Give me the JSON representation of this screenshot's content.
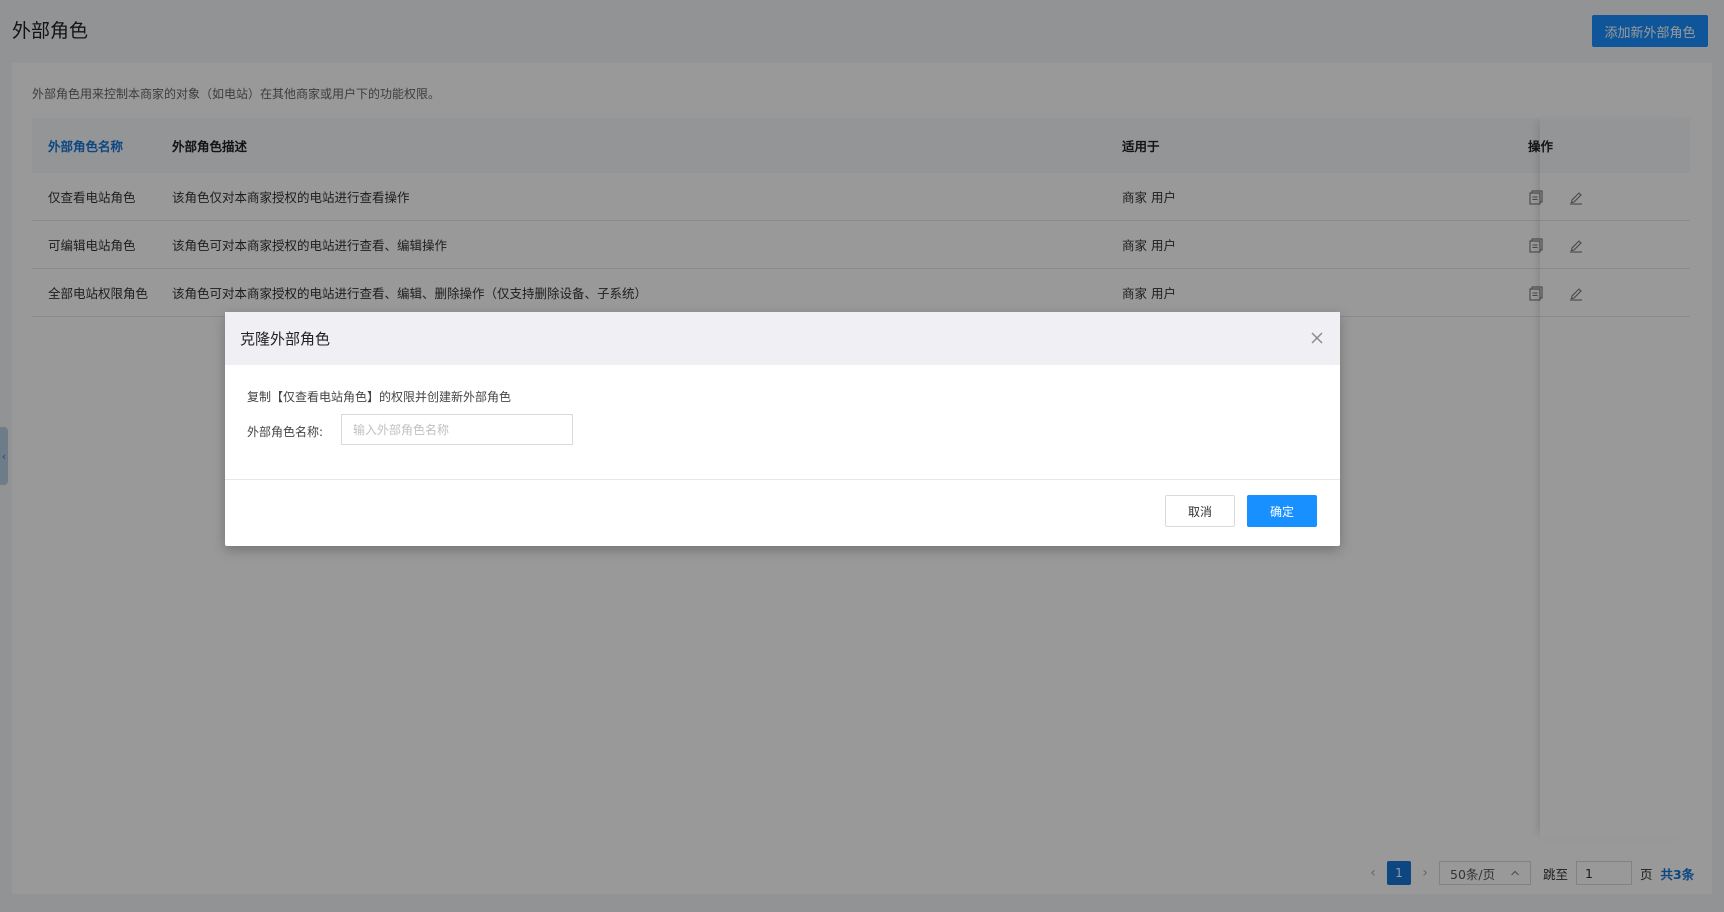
{
  "page": {
    "title": "外部角色",
    "add_button_label": "添加新外部角色",
    "description": "外部角色用来控制本商家的对象（如电站）在其他商家或用户下的功能权限。"
  },
  "table": {
    "headers": {
      "name": "外部角色名称",
      "description": "外部角色描述",
      "applies_to": "适用于",
      "operations": "操作"
    },
    "rows": [
      {
        "name": "仅查看电站角色",
        "description": "该角色仅对本商家授权的电站进行查看操作",
        "applies_to": "商家 用户"
      },
      {
        "name": "可编辑电站角色",
        "description": "该角色可对本商家授权的电站进行查看、编辑操作",
        "applies_to": "商家 用户"
      },
      {
        "name": "全部电站权限角色",
        "description": "该角色可对本商家授权的电站进行查看、编辑、删除操作（仅支持删除设备、子系统）",
        "applies_to": "商家 用户"
      }
    ]
  },
  "pagination": {
    "current_page": "1",
    "page_size": "50条/页",
    "jump_label": "跳至",
    "jump_value": "1",
    "page_unit": "页",
    "total": "共3条"
  },
  "modal": {
    "title": "克隆外部角色",
    "tip": "复制【仅查看电站角色】的权限并创建新外部角色",
    "field_label": "外部角色名称:",
    "field_placeholder": "输入外部角色名称",
    "field_value": "",
    "cancel_label": "取消",
    "ok_label": "确定"
  },
  "icons": {
    "clone": "clone-icon",
    "edit": "edit-icon",
    "close": "close-icon",
    "prev": "chevron-left-icon",
    "next": "chevron-right-icon",
    "size_toggle": "chevron-up-icon",
    "sidebar_toggle": "chevron-left-icon"
  },
  "colors": {
    "primary": "#1890ff",
    "link": "#1677d9"
  }
}
